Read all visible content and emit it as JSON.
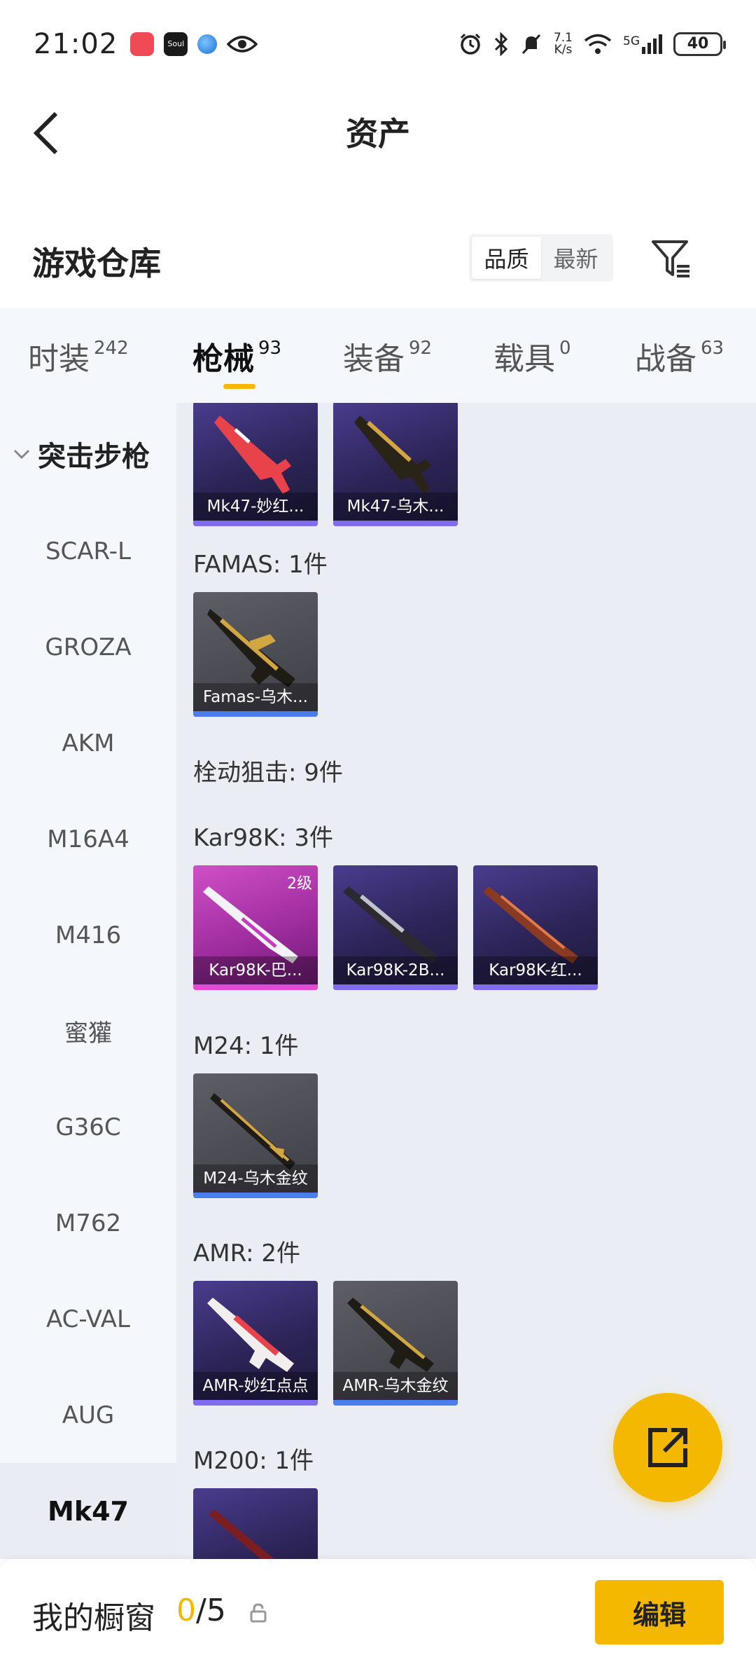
{
  "status_bar": {
    "time": "21:02",
    "net_speed_value": "7.1",
    "net_speed_unit": "K/s",
    "signal_label": "5G",
    "battery": "40"
  },
  "header": {
    "title": "资产"
  },
  "warehouse": {
    "title": "游戏仓库",
    "sort_options": [
      "品质",
      "最新"
    ],
    "sort_active": "品质"
  },
  "tabs": [
    {
      "label": "时装",
      "count": "242"
    },
    {
      "label": "枪械",
      "count": "93"
    },
    {
      "label": "装备",
      "count": "92"
    },
    {
      "label": "载具",
      "count": "0"
    },
    {
      "label": "战备",
      "count": "63"
    }
  ],
  "sidebar": {
    "group_label": "突击步枪",
    "items": [
      "SCAR-L",
      "GROZA",
      "AKM",
      "M16A4",
      "M416",
      "蜜獾",
      "G36C",
      "M762",
      "AC-VAL",
      "AUG",
      "Mk47"
    ],
    "active_item": "Mk47"
  },
  "content": {
    "mk47_items": [
      "Mk47-妙红...",
      "Mk47-乌木..."
    ],
    "famas_label": "FAMAS: 1件",
    "famas_items": [
      "Famas-乌木..."
    ],
    "bolt_label": "栓动狙击: 9件",
    "kar_label": "Kar98K: 3件",
    "kar_items": [
      {
        "name": "Kar98K-巴...",
        "badge": "2级"
      },
      {
        "name": "Kar98K-2B..."
      },
      {
        "name": "Kar98K-红..."
      }
    ],
    "m24_label": "M24: 1件",
    "m24_items": [
      "M24-乌木金纹"
    ],
    "amr_label": "AMR: 2件",
    "amr_items": [
      "AMR-妙红点点",
      "AMR-乌木金纹"
    ],
    "m200_label": "M200: 1件"
  },
  "bottom_bar": {
    "title": "我的橱窗",
    "used": "0",
    "total": "/5",
    "edit_label": "编辑"
  },
  "colors": {
    "accent": "#f5b800",
    "quality_purple": "#7f6cf0",
    "quality_pink": "#e64ad4",
    "quality_blue": "#4d7cf0"
  }
}
